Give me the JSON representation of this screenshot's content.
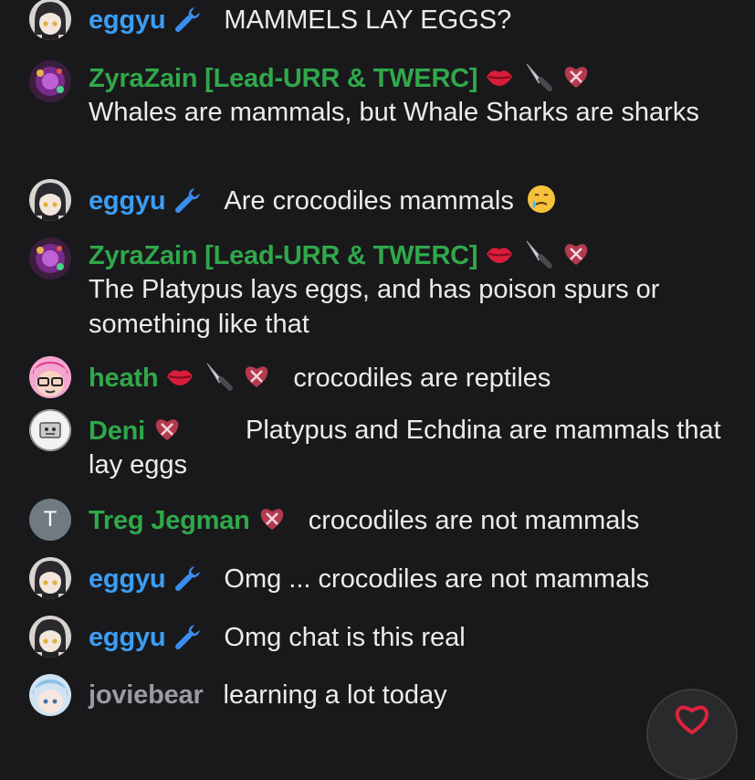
{
  "colors": {
    "background": "#19191b",
    "text": "#ececee",
    "name_blue": "#3b9ef5",
    "name_green": "#30a84a",
    "name_gray": "#9a9aa0"
  },
  "icons": {
    "wrench": "wrench-icon",
    "lips": "lips-icon",
    "knife": "knife-icon",
    "heart_badge": "heart-badge-icon",
    "crying": "crying-face-emoji",
    "react": "heart-react-icon"
  },
  "messages": [
    {
      "user": "eggyu",
      "text": "MAMMELS LAY EGGS?"
    },
    {
      "user": "ZyraZain [Lead-URR & TWERC]",
      "text": "Whales are mammals, but Whale Sharks are sharks"
    },
    {
      "user": "eggyu",
      "text": "Are crocodiles mammals"
    },
    {
      "user": "ZyraZain [Lead-URR & TWERC]",
      "text": "The Platypus lays eggs, and has poison spurs or something like that"
    },
    {
      "user": "heath",
      "text": "crocodiles are reptiles"
    },
    {
      "user": "Deni",
      "text": "Platypus and Echdina are mammals that lay eggs"
    },
    {
      "user": "Treg Jegman",
      "avatar_letter": "T",
      "text": "crocodiles are not mammals"
    },
    {
      "user": "eggyu",
      "text": "Omg ... crocodiles are not mammals"
    },
    {
      "user": "eggyu",
      "text": "Omg chat is this real"
    },
    {
      "user": "joviebear",
      "text": "learning a lot today"
    }
  ]
}
